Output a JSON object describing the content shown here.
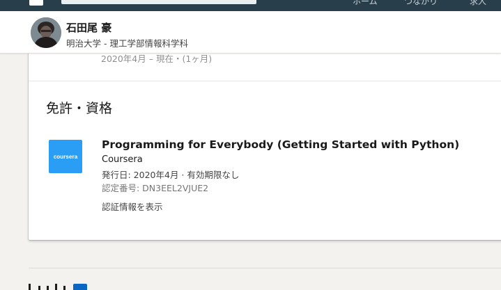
{
  "nav": {
    "items": [
      {
        "label": "ホーム"
      },
      {
        "label": "つながり"
      },
      {
        "label": "求人"
      }
    ]
  },
  "profile": {
    "name": "石田尾 豪",
    "headline": "明治大学 - 理工学部情報科学科"
  },
  "previous_entry": {
    "duration": "2020年4月 – 現在・(1ヶ月)"
  },
  "licenses_section": {
    "title": "免許・資格",
    "items": [
      {
        "logo_text": "coursera",
        "logo_color": "#2a9df4",
        "title": "Programming for Everybody (Getting Started with Python)",
        "issuer": "Coursera",
        "issued": "発行日: 2020年4月 · 有効期限なし",
        "credential_id": "認定番号: DN3EEL2VJUE2",
        "show_credential_label": "認証情報を表示"
      }
    ]
  },
  "colors": {
    "nav_background": "#283e4a",
    "page_background": "#f3f2ef",
    "brand_blue": "#0a66c2"
  }
}
